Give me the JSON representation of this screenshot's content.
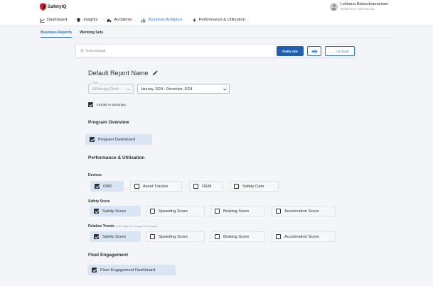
{
  "app": {
    "logo_text": "SafetyIQ",
    "accent_color": "#1f5fae"
  },
  "user": {
    "name": "Lekhana Balasubramaniam",
    "role": "Mobilit Dme Administrator"
  },
  "nav": [
    {
      "label": "Dashboard",
      "icon": "line-chart-icon",
      "active": false
    },
    {
      "label": "Insights",
      "icon": "lightbulb-icon",
      "active": false
    },
    {
      "label": "Accidents",
      "icon": "car-crash-icon",
      "active": false
    },
    {
      "label": "Business Analytics",
      "icon": "bar-chart-icon",
      "active": true
    },
    {
      "label": "Performance & Utilization",
      "icon": "bolt-icon",
      "active": false
    }
  ],
  "subtabs": [
    {
      "label": "Business Reports",
      "active": true
    },
    {
      "label": "Working Sets",
      "active": false
    }
  ],
  "actionbar": {
    "reset_label": "Reset Default",
    "publish_label": "PUBLISH",
    "back_label": "Go back"
  },
  "report": {
    "title": "Default Report Name",
    "fleet_label": "Fleet",
    "fleet_value": "All Azuga Fleet",
    "date_range": "January, 2024 - December, 2024",
    "ai_summary_label": "Include AI Summary",
    "ai_summary_checked": true
  },
  "sections": {
    "program_overview": "Program Overview",
    "performance": "Performance & Utilisation",
    "fleet_engagement": "Fleet Engagement"
  },
  "program_options": [
    {
      "label": "Program Dashboard",
      "checked": true
    }
  ],
  "devices": {
    "label": "Devices",
    "options": [
      {
        "label": "OBD",
        "checked": true
      },
      {
        "label": "Asset Tracker",
        "checked": false
      },
      {
        "label": "OEM",
        "checked": false
      },
      {
        "label": "Safety Cam",
        "checked": false
      }
    ]
  },
  "safety_score": {
    "label": "Safety Score",
    "options": [
      {
        "label": "Safety Score",
        "checked": true
      },
      {
        "label": "Speeding Score",
        "checked": false
      },
      {
        "label": "Braking Score",
        "checked": false
      },
      {
        "label": "Acceleration Score",
        "checked": false
      }
    ]
  },
  "relative_trends": {
    "label": "Relative Trends",
    "note": "(date range will not apply for this page)",
    "options": [
      {
        "label": "Safety Score",
        "checked": true
      },
      {
        "label": "Speeding Score",
        "checked": false
      },
      {
        "label": "Braking Score",
        "checked": false
      },
      {
        "label": "Acceleration Score",
        "checked": false
      }
    ]
  },
  "fleet_options": [
    {
      "label": "Fleet Engagement Dashboard",
      "checked": true
    }
  ]
}
